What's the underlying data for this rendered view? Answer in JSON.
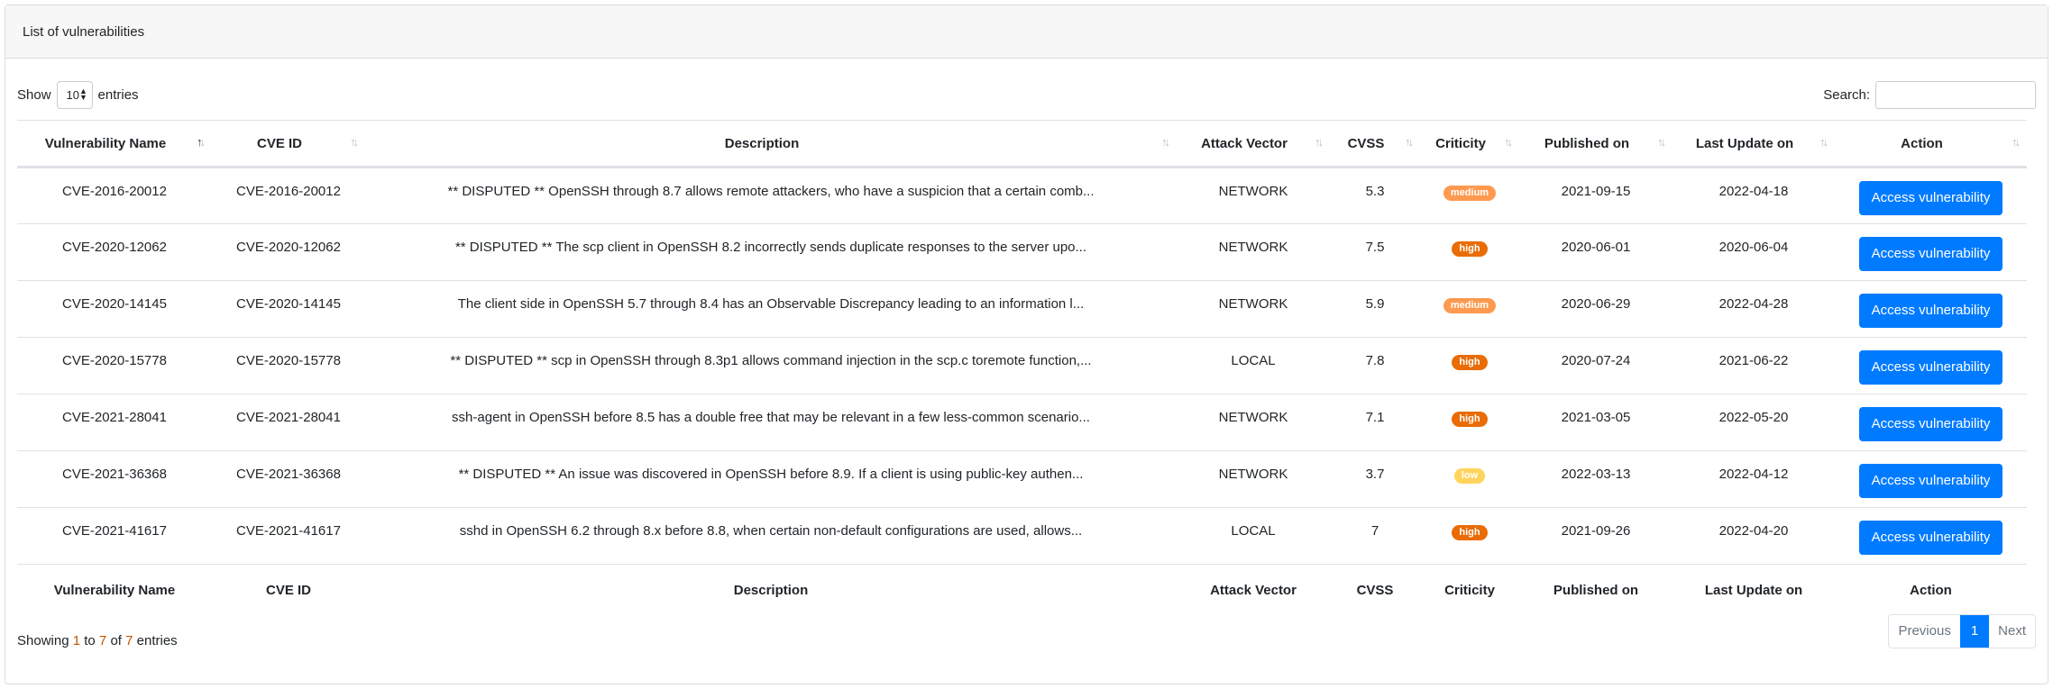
{
  "card": {
    "title": "List of vulnerabilities"
  },
  "controls": {
    "show_label": "Show",
    "length_value": "10",
    "entries_label": "entries",
    "search_label": "Search:",
    "search_value": ""
  },
  "columns": [
    "Vulnerability Name",
    "CVE ID",
    "Description",
    "Attack Vector",
    "CVSS",
    "Criticity",
    "Published on",
    "Last Update on",
    "Action"
  ],
  "criticity_colors": {
    "medium": "#fd9a50",
    "high": "#e96c06",
    "low": "#ffd45e"
  },
  "accent_color": "#007bff",
  "rows": [
    {
      "name": "CVE-2016-20012",
      "cve": "CVE-2016-20012",
      "description": "** DISPUTED ** OpenSSH through 8.7 allows remote attackers, who have a suspicion that a certain comb...",
      "vector": "NETWORK",
      "cvss": "5.3",
      "criticity": "medium",
      "published": "2021-09-15",
      "updated": "2022-04-18",
      "action": "Access vulnerability"
    },
    {
      "name": "CVE-2020-12062",
      "cve": "CVE-2020-12062",
      "description": "** DISPUTED ** The scp client in OpenSSH 8.2 incorrectly sends duplicate responses to the server upo...",
      "vector": "NETWORK",
      "cvss": "7.5",
      "criticity": "high",
      "published": "2020-06-01",
      "updated": "2020-06-04",
      "action": "Access vulnerability"
    },
    {
      "name": "CVE-2020-14145",
      "cve": "CVE-2020-14145",
      "description": "The client side in OpenSSH 5.7 through 8.4 has an Observable Discrepancy leading to an information l...",
      "vector": "NETWORK",
      "cvss": "5.9",
      "criticity": "medium",
      "published": "2020-06-29",
      "updated": "2022-04-28",
      "action": "Access vulnerability"
    },
    {
      "name": "CVE-2020-15778",
      "cve": "CVE-2020-15778",
      "description": "** DISPUTED ** scp in OpenSSH through 8.3p1 allows command injection in the scp.c toremote function,...",
      "vector": "LOCAL",
      "cvss": "7.8",
      "criticity": "high",
      "published": "2020-07-24",
      "updated": "2021-06-22",
      "action": "Access vulnerability"
    },
    {
      "name": "CVE-2021-28041",
      "cve": "CVE-2021-28041",
      "description": "ssh-agent in OpenSSH before 8.5 has a double free that may be relevant in a few less-common scenario...",
      "vector": "NETWORK",
      "cvss": "7.1",
      "criticity": "high",
      "published": "2021-03-05",
      "updated": "2022-05-20",
      "action": "Access vulnerability"
    },
    {
      "name": "CVE-2021-36368",
      "cve": "CVE-2021-36368",
      "description": "** DISPUTED ** An issue was discovered in OpenSSH before 8.9. If a client is using public-key authen...",
      "vector": "NETWORK",
      "cvss": "3.7",
      "criticity": "low",
      "published": "2022-03-13",
      "updated": "2022-04-12",
      "action": "Access vulnerability"
    },
    {
      "name": "CVE-2021-41617",
      "cve": "CVE-2021-41617",
      "description": "sshd in OpenSSH 6.2 through 8.x before 8.8, when certain non-default configurations are used, allows...",
      "vector": "LOCAL",
      "cvss": "7",
      "criticity": "high",
      "published": "2021-09-26",
      "updated": "2022-04-20",
      "action": "Access vulnerability"
    }
  ],
  "info": {
    "prefix": "Showing",
    "from": "1",
    "to_word": "to",
    "to": "7",
    "of_word": "of",
    "total": "7",
    "suffix": "entries"
  },
  "pagination": {
    "previous": "Previous",
    "current": "1",
    "next": "Next"
  }
}
